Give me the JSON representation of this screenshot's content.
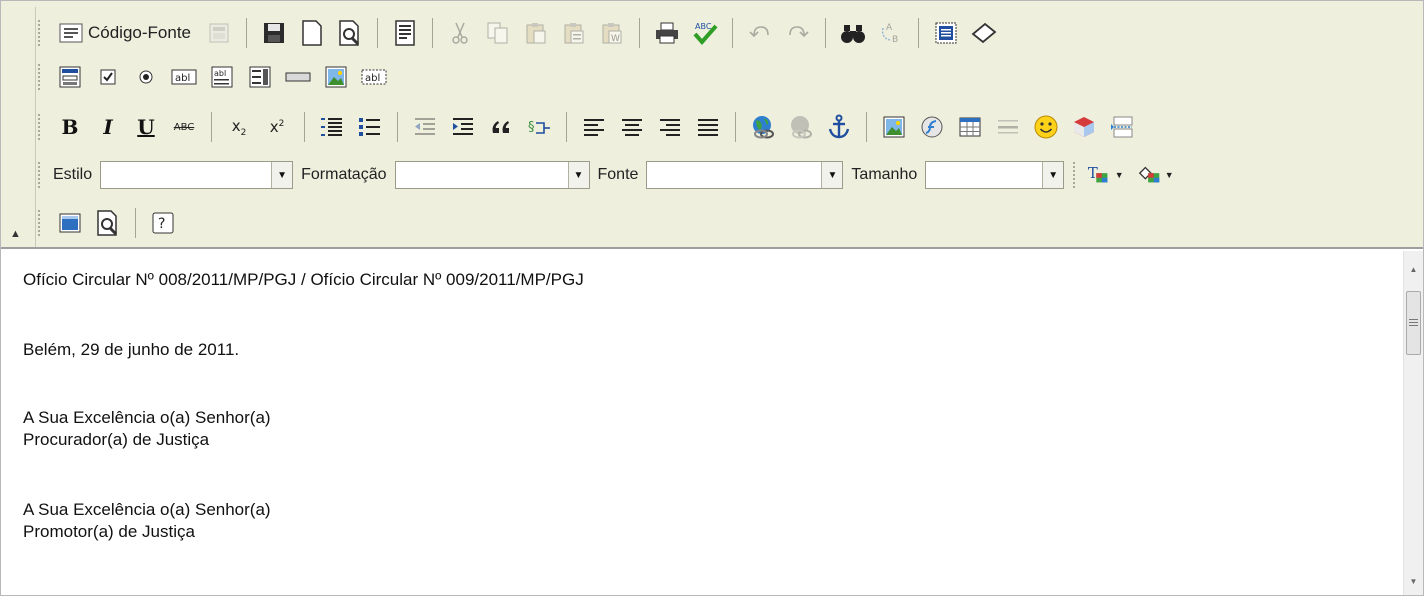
{
  "toolbar": {
    "source_label": "Código-Fonte",
    "style_label": "Estilo",
    "style_value": "",
    "format_label": "Formatação",
    "format_value": "",
    "font_label": "Fonte",
    "font_value": "",
    "size_label": "Tamanho",
    "size_value": "",
    "bold": "B",
    "italic": "I",
    "underline": "U",
    "strike": "ABC",
    "subscript_x": "x",
    "subscript_n": "2",
    "superscript_x": "x",
    "superscript_n": "2",
    "text_field": "abl",
    "textarea": "abl",
    "hidden_field": "abl",
    "spellcheck": "ABC",
    "text_color": "T",
    "help": "?"
  },
  "colors": {
    "toolbar_bg": "#efefde",
    "accent_blue": "#1f4f9e",
    "check_green": "#2e9e25"
  },
  "content": {
    "line1": "Ofício Circular Nº 008/2011/MP/PGJ / Ofício Circular Nº 009/2011/MP/PGJ",
    "line2": "Belém, 29 de junho de 2011.",
    "line3": "A Sua Excelência o(a) Senhor(a)",
    "line4": "Procurador(a) de Justiça",
    "line5": "A Sua Excelência o(a) Senhor(a)",
    "line6": "Promotor(a) de Justiça"
  }
}
